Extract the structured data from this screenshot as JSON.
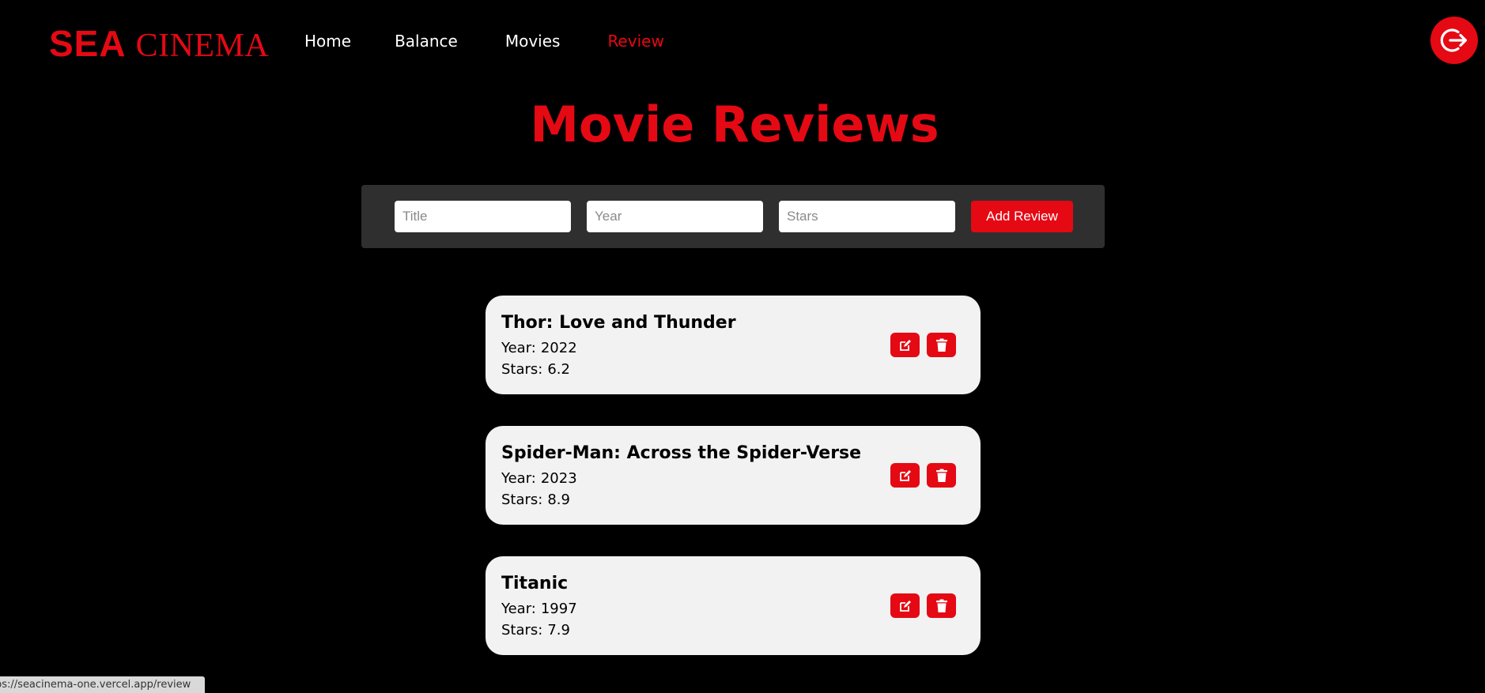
{
  "brand": {
    "part1": "SEA",
    "part2": "CINEMA",
    "color": "#e50914"
  },
  "nav": {
    "items": [
      {
        "label": "Home",
        "active": false
      },
      {
        "label": "Balance",
        "active": false
      },
      {
        "label": "Movies",
        "active": false
      },
      {
        "label": "Review",
        "active": true
      }
    ]
  },
  "header": {
    "logout_icon": "logout-icon"
  },
  "page": {
    "title": "Movie Reviews"
  },
  "form": {
    "title_placeholder": "Title",
    "year_placeholder": "Year",
    "stars_placeholder": "Stars",
    "submit_label": "Add Review"
  },
  "reviews": [
    {
      "title": "Thor: Love and Thunder",
      "year_label": "Year:",
      "year": "2022",
      "stars_label": "Stars:",
      "stars": "6.2",
      "edit_icon": "edit-icon",
      "delete_icon": "trash-icon"
    },
    {
      "title": "Spider-Man: Across the Spider-Verse",
      "year_label": "Year:",
      "year": "2023",
      "stars_label": "Stars:",
      "stars": "8.9",
      "edit_icon": "edit-icon",
      "delete_icon": "trash-icon"
    },
    {
      "title": "Titanic",
      "year_label": "Year:",
      "year": "1997",
      "stars_label": "Stars:",
      "stars": "7.9",
      "edit_icon": "edit-icon",
      "delete_icon": "trash-icon"
    }
  ],
  "status_bar": {
    "url": "ps://seacinema-one.vercel.app/review"
  },
  "colors": {
    "accent": "#e50914",
    "background": "#000000",
    "form_bg": "#2f2f2f",
    "card_bg": "#f2f2f2"
  }
}
